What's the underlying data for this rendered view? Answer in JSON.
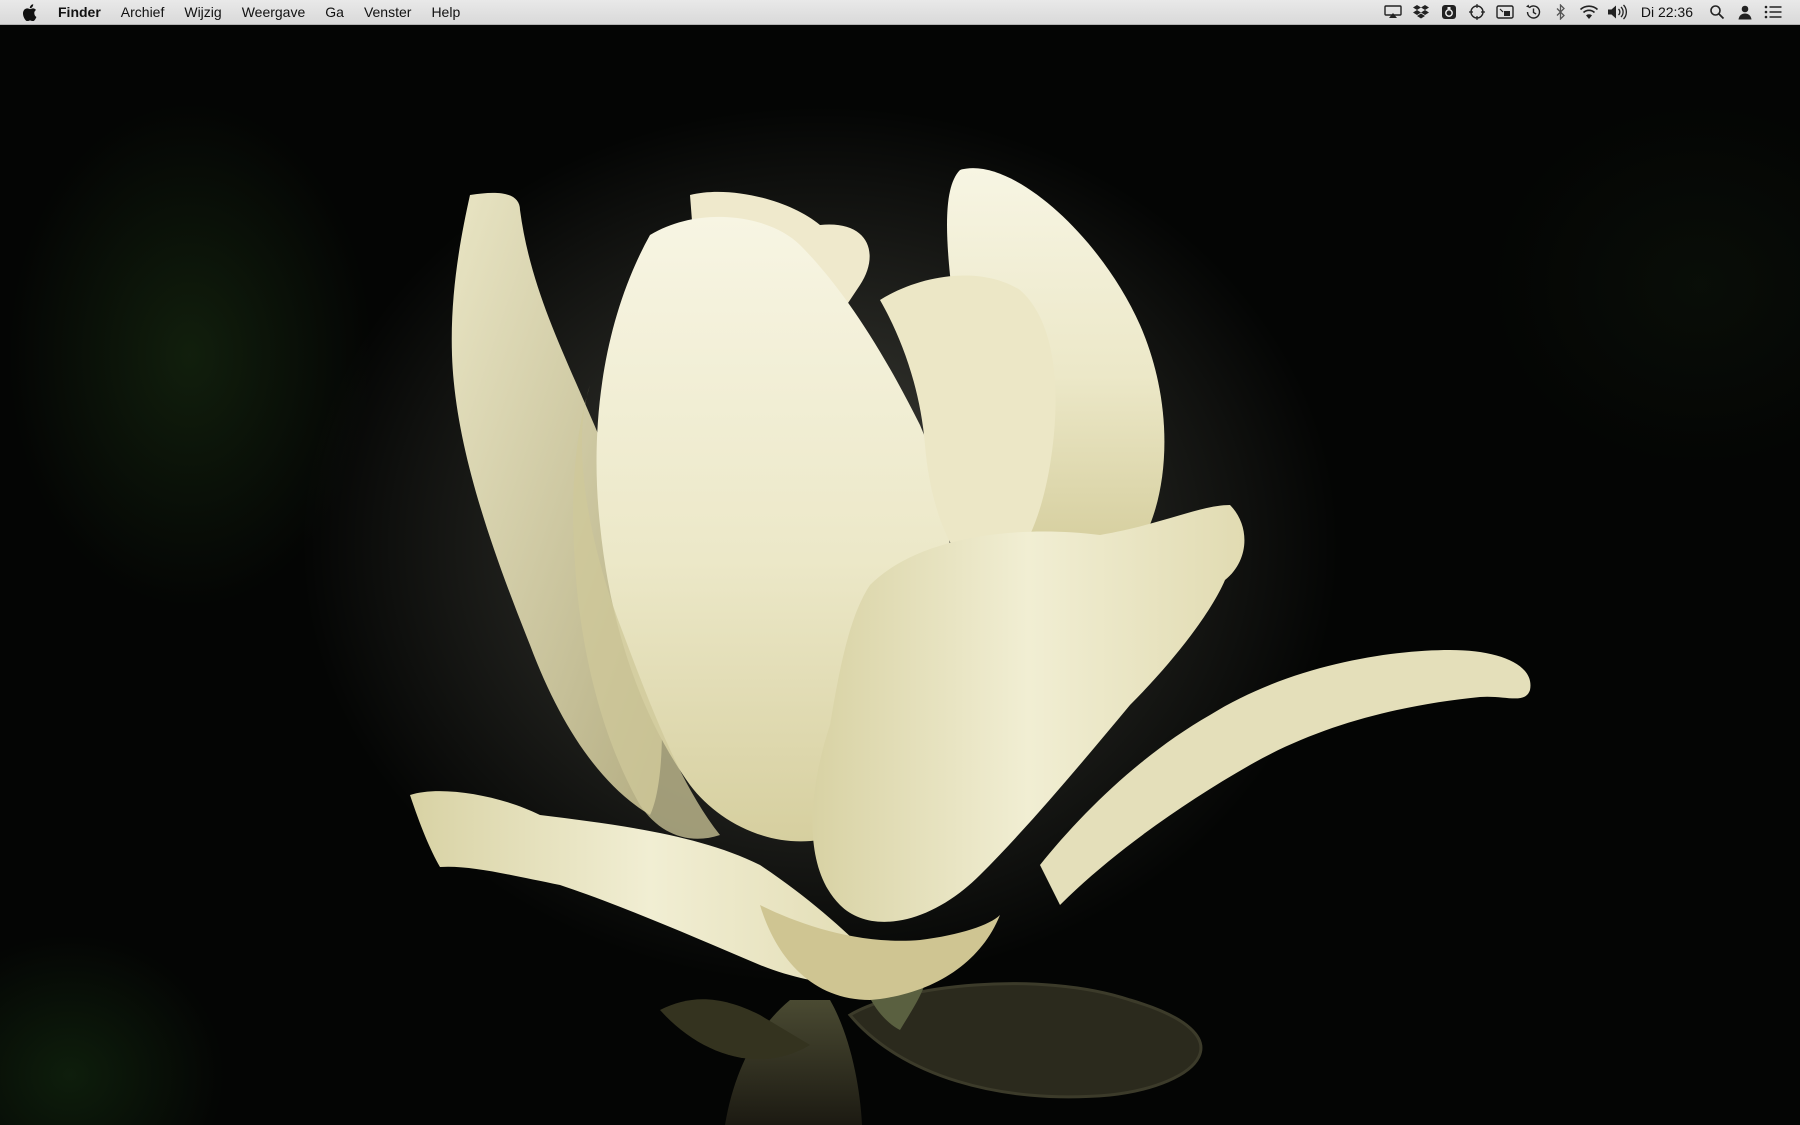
{
  "menubar": {
    "apple_icon": "apple-logo-icon",
    "app_name": "Finder",
    "menus": [
      "Archief",
      "Wijzig",
      "Weergave",
      "Ga",
      "Venster",
      "Help"
    ],
    "status_icons": [
      "airplay-icon",
      "dropbox-icon",
      "app-status-icon",
      "sync-circle-icon",
      "screen-capture-icon",
      "time-machine-icon",
      "bluetooth-icon",
      "wifi-icon",
      "volume-icon"
    ],
    "clock": "Di 22:36",
    "right_icons": [
      "spotlight-search-icon",
      "user-account-icon",
      "notification-center-icon"
    ]
  },
  "desktop": {
    "wallpaper": "white-magnolia-flower",
    "colors": {
      "background": "#040504",
      "petal_light": "#f3f1dc",
      "petal_mid": "#d9d4b0",
      "petal_shadow": "#a8a27a",
      "stem": "#3b3a2c"
    }
  }
}
